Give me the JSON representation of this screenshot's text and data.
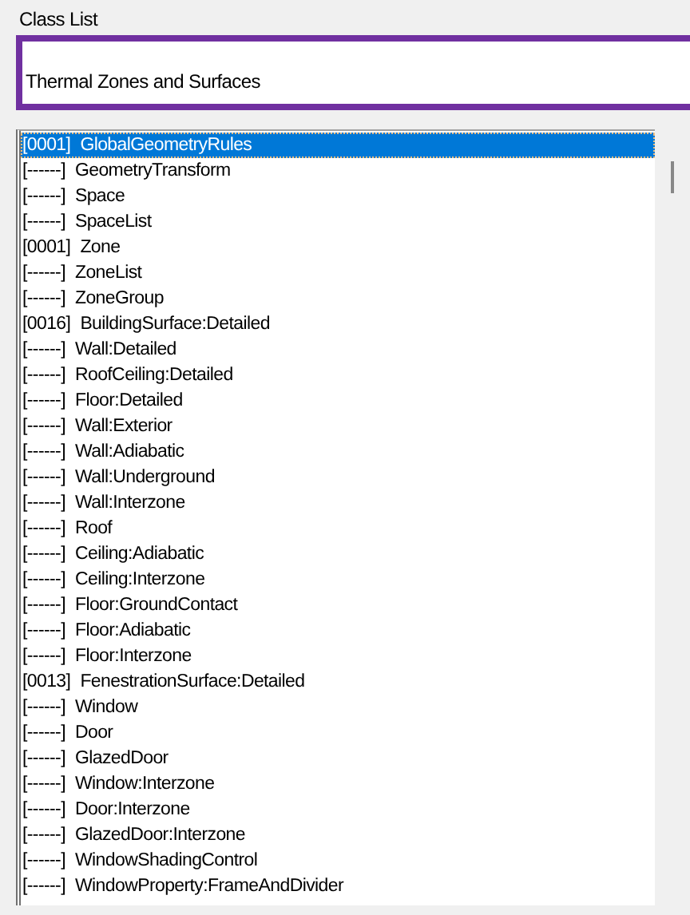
{
  "class_list": {
    "label": "Class List",
    "filter": {
      "value": "Thermal Zones and Surfaces"
    },
    "items": [
      {
        "count": "[0001]",
        "name": "GlobalGeometryRules",
        "selected": true
      },
      {
        "count": "[------]",
        "name": "GeometryTransform",
        "selected": false
      },
      {
        "count": "[------]",
        "name": "Space",
        "selected": false
      },
      {
        "count": "[------]",
        "name": "SpaceList",
        "selected": false
      },
      {
        "count": "[0001]",
        "name": "Zone",
        "selected": false
      },
      {
        "count": "[------]",
        "name": "ZoneList",
        "selected": false
      },
      {
        "count": "[------]",
        "name": "ZoneGroup",
        "selected": false
      },
      {
        "count": "[0016]",
        "name": "BuildingSurface:Detailed",
        "selected": false
      },
      {
        "count": "[------]",
        "name": "Wall:Detailed",
        "selected": false
      },
      {
        "count": "[------]",
        "name": "RoofCeiling:Detailed",
        "selected": false
      },
      {
        "count": "[------]",
        "name": "Floor:Detailed",
        "selected": false
      },
      {
        "count": "[------]",
        "name": "Wall:Exterior",
        "selected": false
      },
      {
        "count": "[------]",
        "name": "Wall:Adiabatic",
        "selected": false
      },
      {
        "count": "[------]",
        "name": "Wall:Underground",
        "selected": false
      },
      {
        "count": "[------]",
        "name": "Wall:Interzone",
        "selected": false
      },
      {
        "count": "[------]",
        "name": "Roof",
        "selected": false
      },
      {
        "count": "[------]",
        "name": "Ceiling:Adiabatic",
        "selected": false
      },
      {
        "count": "[------]",
        "name": "Ceiling:Interzone",
        "selected": false
      },
      {
        "count": "[------]",
        "name": "Floor:GroundContact",
        "selected": false
      },
      {
        "count": "[------]",
        "name": "Floor:Adiabatic",
        "selected": false
      },
      {
        "count": "[------]",
        "name": "Floor:Interzone",
        "selected": false
      },
      {
        "count": "[0013]",
        "name": "FenestrationSurface:Detailed",
        "selected": false
      },
      {
        "count": "[------]",
        "name": "Window",
        "selected": false
      },
      {
        "count": "[------]",
        "name": "Door",
        "selected": false
      },
      {
        "count": "[------]",
        "name": "GlazedDoor",
        "selected": false
      },
      {
        "count": "[------]",
        "name": "Window:Interzone",
        "selected": false
      },
      {
        "count": "[------]",
        "name": "Door:Interzone",
        "selected": false
      },
      {
        "count": "[------]",
        "name": "GlazedDoor:Interzone",
        "selected": false
      },
      {
        "count": "[------]",
        "name": "WindowShadingControl",
        "selected": false
      },
      {
        "count": "[------]",
        "name": "WindowProperty:FrameAndDivider",
        "selected": false
      }
    ]
  }
}
